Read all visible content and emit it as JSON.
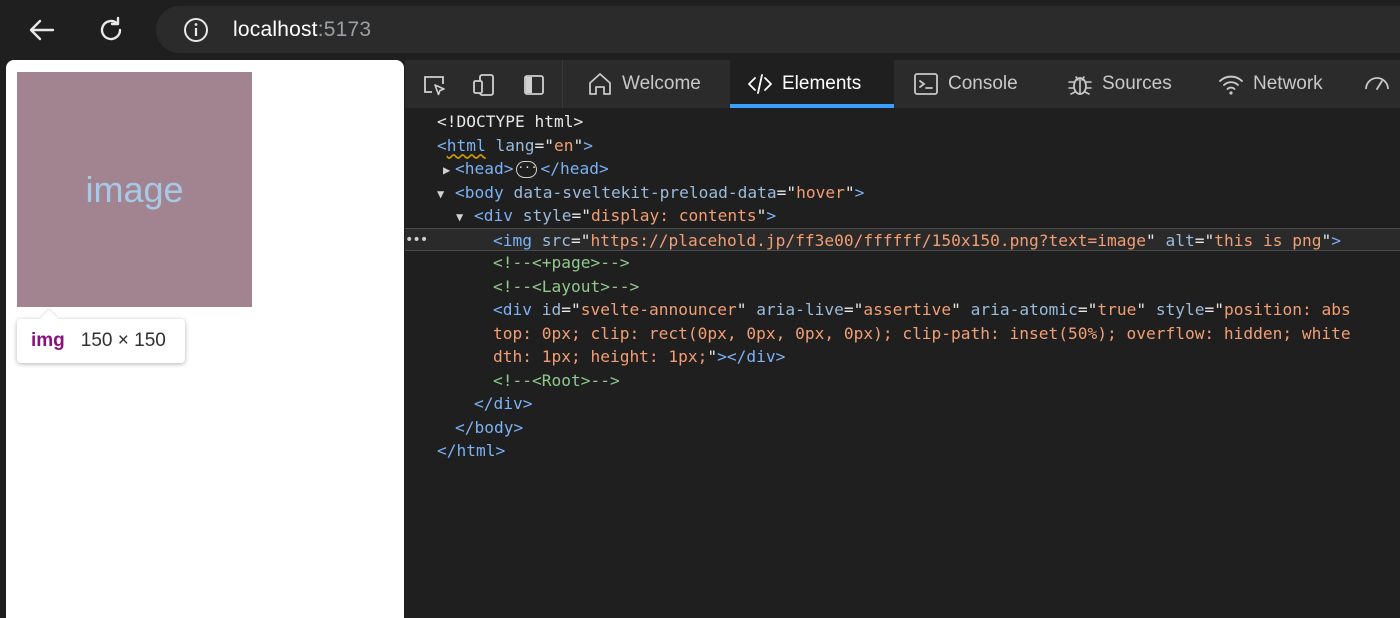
{
  "browser": {
    "url_host": "localhost",
    "url_port": ":5173"
  },
  "page": {
    "image_text": "image",
    "tooltip_tag": "img",
    "tooltip_size": "150 × 150"
  },
  "devtools": {
    "tabs": [
      {
        "label": "Welcome",
        "icon": "home-icon"
      },
      {
        "label": "Elements",
        "icon": "code-icon"
      },
      {
        "label": "Console",
        "icon": "console-icon"
      },
      {
        "label": "Sources",
        "icon": "bug-icon"
      },
      {
        "label": "Network",
        "icon": "wifi-icon"
      }
    ],
    "active_tab": "Elements",
    "accent_color": "#3aa0ff",
    "dom": {
      "doctype": "<!DOCTYPE html>",
      "html_tag": "html",
      "html_attr_lang": "lang",
      "html_lang_value": "en",
      "head_open": "<head>",
      "head_close": "</head>",
      "body_tag": "body",
      "body_attr": "data-sveltekit-preload-data",
      "body_attr_value": "hover",
      "div_tag": "div",
      "div_attr": "style",
      "div_attr_value": "display: contents",
      "img_tag": "img",
      "img_src_attr": "src",
      "img_src_value": "https://placehold.jp/ff3e00/ffffff/150x150.png?text=image",
      "img_alt_attr": "alt",
      "img_alt_value": "this is png",
      "comment_page": "<!--<+page>-->",
      "comment_layout": "<!--<Layout>-->",
      "announcer_id_attr": "id",
      "announcer_id_value": "svelte-announcer",
      "announcer_live_attr": "aria-live",
      "announcer_live_value": "assertive",
      "announcer_atomic_attr": "aria-atomic",
      "announcer_atomic_value": "true",
      "announcer_style_attr": "style",
      "announcer_style_part1": "position: abs",
      "announcer_style_part2": "top: 0px; clip: rect(0px, 0px, 0px, 0px); clip-path: inset(50%); overflow: hidden; white",
      "announcer_style_part3": "dth: 1px; height: 1px;",
      "comment_root": "<!--<Root>-->",
      "div_close": "</div>",
      "body_close": "</body>",
      "html_close": "</html>"
    }
  }
}
